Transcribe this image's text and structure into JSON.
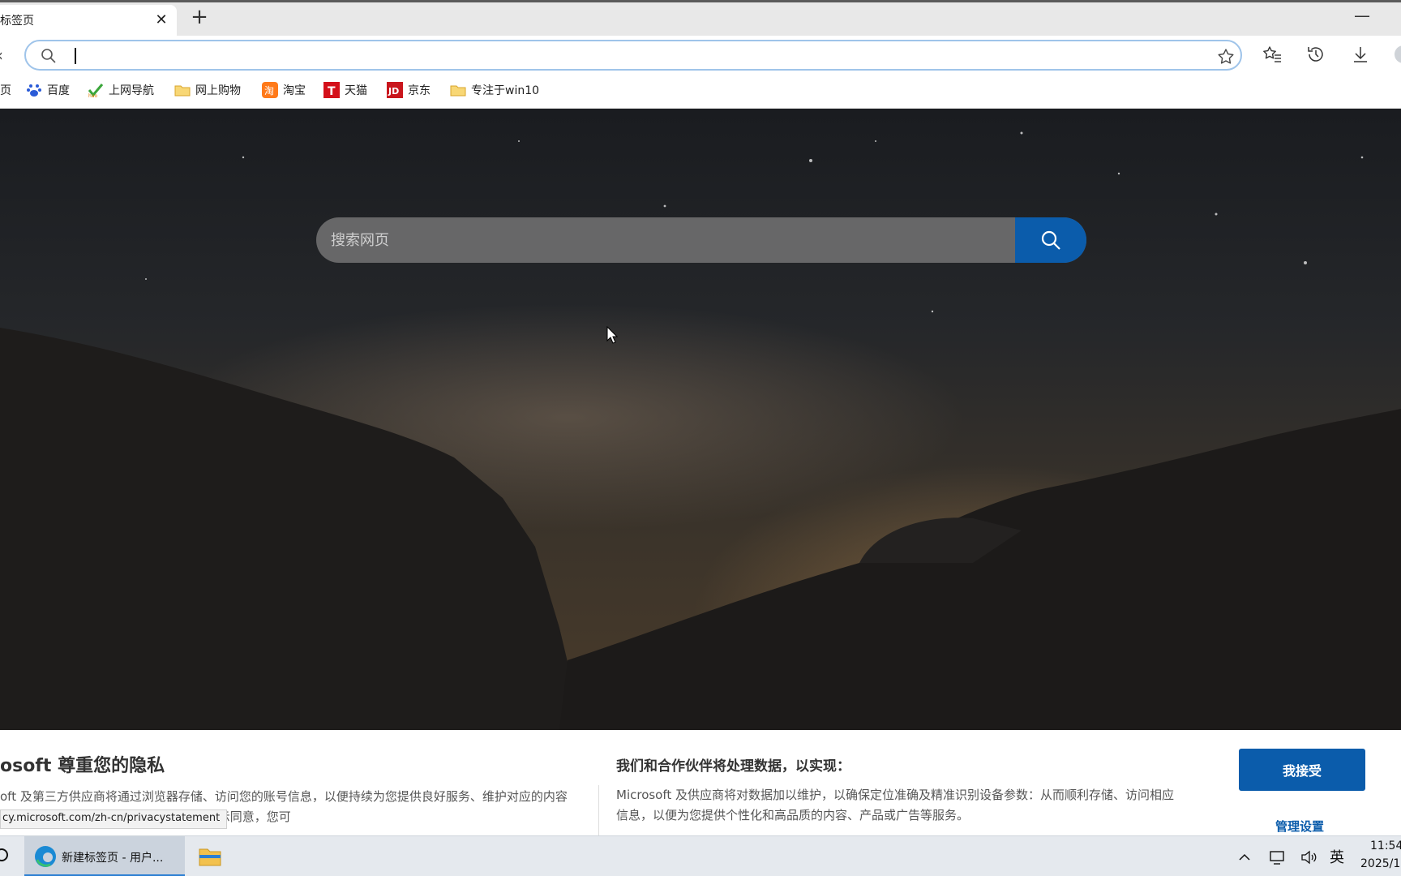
{
  "browser": {
    "tab": {
      "title": "标签页",
      "close": "✕"
    },
    "new_tab": "+",
    "minimize": "—",
    "address": {
      "value": "",
      "placeholder": ""
    },
    "bookmarks": [
      {
        "label": "页",
        "icon": "page-icon"
      },
      {
        "label": "百度",
        "icon": "baidu-icon"
      },
      {
        "label": "上网导航",
        "icon": "hao123-icon"
      },
      {
        "label": "网上购物",
        "icon": "folder-icon"
      },
      {
        "label": "淘宝",
        "icon": "taobao-icon"
      },
      {
        "label": "天猫",
        "icon": "tmall-icon"
      },
      {
        "label": "京东",
        "icon": "jd-icon"
      },
      {
        "label": "专注于win10",
        "icon": "folder-icon"
      }
    ]
  },
  "page": {
    "search_placeholder": "搜索网页"
  },
  "privacy": {
    "title": "osoft 尊重您的隐私",
    "text": "oft 及第三方供应商将通过浏览器存储、访问您的账号信息，以便持续为您提供良好服务、维护对应的内容及广告。您可以通过点击选择\"我接受\"以示同意，您可",
    "partners_title": "我们和合作伙伴将处理数据，以实现：",
    "partners_text": "Microsoft 及供应商将对数据加以维护，以确保定位准确及精准识别设备参数：从而顺利存储、访问相应信息，以便为您提供个性化和高品质的内容、产品或广告等服务。",
    "accept_label": "我接受",
    "manage_label": "管理设置",
    "status_url": "cy.microsoft.com/zh-cn/privacystatement"
  },
  "taskbar": {
    "edge_label": "新建标签页 - 用户...",
    "ime": "英",
    "time": "11:54",
    "date": "2025/1"
  },
  "colors": {
    "accent": "#0b5cab",
    "address_border": "#9fc4ea"
  }
}
